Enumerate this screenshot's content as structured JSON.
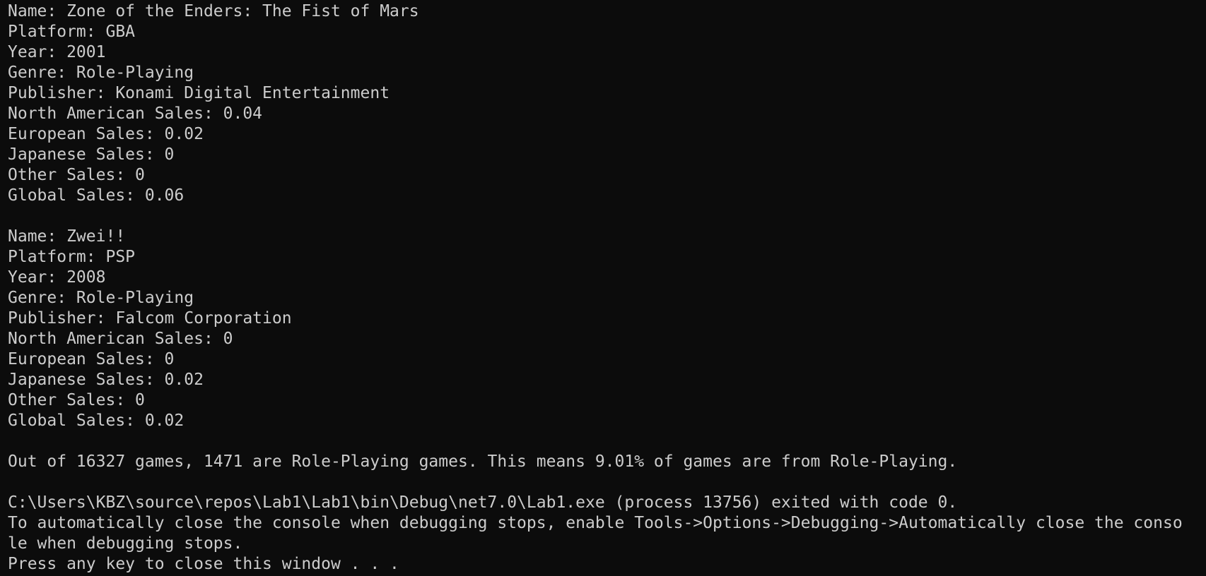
{
  "records": [
    {
      "name": "Name: Zone of the Enders: The Fist of Mars",
      "platform": "Platform: GBA",
      "year": "Year: 2001",
      "genre": "Genre: Role-Playing",
      "publisher": "Publisher: Konami Digital Entertainment",
      "na_sales": "North American Sales: 0.04",
      "eu_sales": "European Sales: 0.02",
      "jp_sales": "Japanese Sales: 0",
      "other_sales": "Other Sales: 0",
      "global_sales": "Global Sales: 0.06"
    },
    {
      "name": "Name: Zwei!!",
      "platform": "Platform: PSP",
      "year": "Year: 2008",
      "genre": "Genre: Role-Playing",
      "publisher": "Publisher: Falcom Corporation",
      "na_sales": "North American Sales: 0",
      "eu_sales": "European Sales: 0",
      "jp_sales": "Japanese Sales: 0.02",
      "other_sales": "Other Sales: 0",
      "global_sales": "Global Sales: 0.02"
    }
  ],
  "summary": "Out of 16327 games, 1471 are Role-Playing games. This means 9.01% of games are from Role-Playing.",
  "exit_message": "C:\\Users\\KBZ\\source\\repos\\Lab1\\Lab1\\bin\\Debug\\net7.0\\Lab1.exe (process 13756) exited with code 0.",
  "hint_line1": "To automatically close the console when debugging stops, enable Tools->Options->Debugging->Automatically close the conso",
  "hint_line2": "le when debugging stops.",
  "prompt": "Press any key to close this window . . .",
  "colors": {
    "background": "#0c0c0c",
    "text": "#cccccc"
  }
}
